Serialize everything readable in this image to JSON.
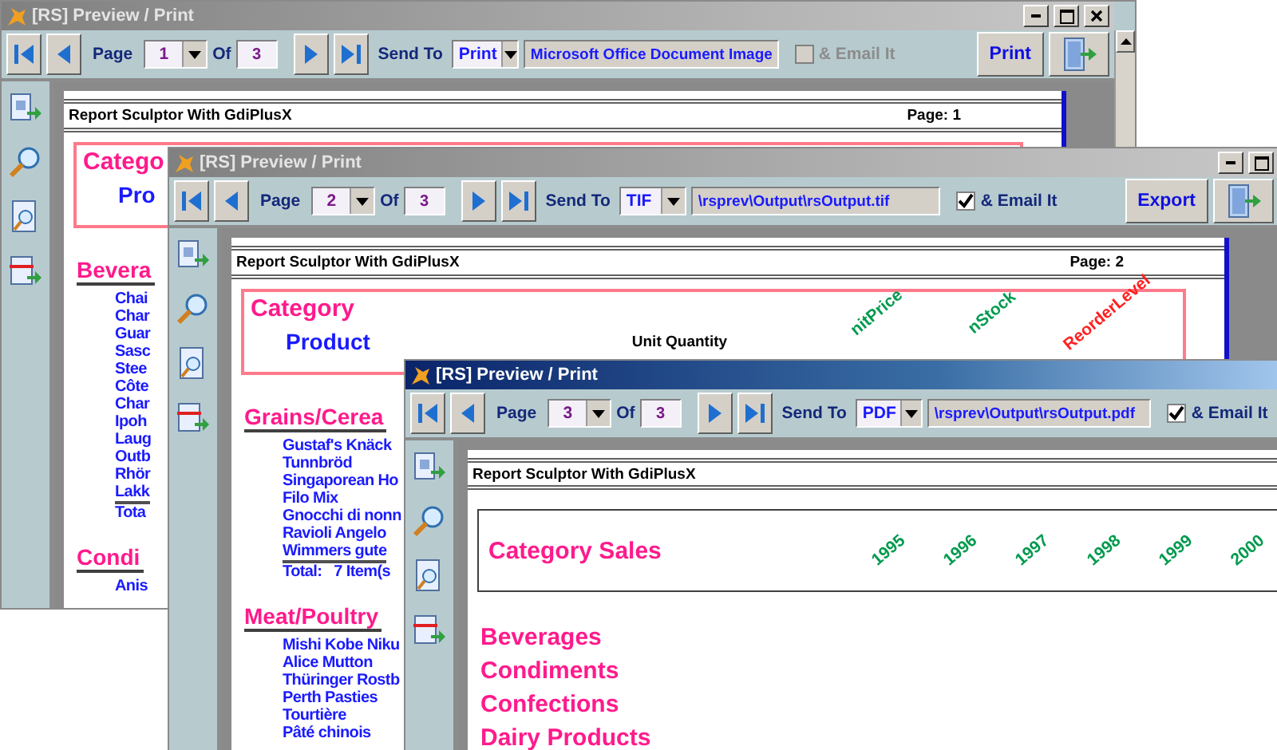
{
  "windows": [
    {
      "title": "[RS] Preview / Print",
      "active": false,
      "title_buttons": [
        {
          "kind": "minimize"
        },
        {
          "kind": "maximize"
        },
        {
          "kind": "close"
        }
      ],
      "page_label": "Page",
      "page_value": "1",
      "of_label": "Of",
      "page_total": "3",
      "send_to_label": "Send To",
      "send_to": "Print",
      "output": "Microsoft Office Document Image",
      "email": {
        "label": "& Email It",
        "checked": false,
        "disabled": true
      },
      "action": "Print",
      "report": {
        "header": "Report Sculptor With GdiPlusX",
        "page": "Page: 1",
        "box": {
          "kind": "detail",
          "title": "Catego",
          "subtitle": "Pro"
        },
        "groups": [
          {
            "kind": "detail",
            "heading": "Bevera",
            "items": [
              "Chai",
              "Char",
              "Guar",
              "Sasc",
              "Stee",
              "Côte",
              "Char",
              "Ipoh",
              "Laug",
              "Outb",
              "Rhör",
              "Lakk"
            ],
            "total": "Tota"
          },
          {
            "kind": "detail",
            "heading": "Condi",
            "items": [
              "Anis"
            ]
          }
        ]
      }
    },
    {
      "title": "[RS] Preview / Print",
      "active": false,
      "title_buttons": [
        {
          "kind": "minimize"
        },
        {
          "kind": "maximize"
        }
      ],
      "page_label": "Page",
      "page_value": "2",
      "of_label": "Of",
      "page_total": "3",
      "send_to_label": "Send To",
      "send_to": "TIF",
      "output": "\\rsprev\\Output\\rsOutput.tif",
      "email": {
        "label": "& Email It",
        "checked": true,
        "disabled": false
      },
      "action": "Export",
      "report": {
        "header": "Report Sculptor With GdiPlusX",
        "page": "Page: 2",
        "box": {
          "kind": "detail",
          "title": "Category",
          "subtitle": "Product",
          "columns": [
            {
              "text": "Unit Quantity",
              "kind": "plain"
            },
            {
              "text": "nitPrice",
              "kind": "slanted",
              "color": "#009a4e"
            },
            {
              "text": "nStock",
              "kind": "slanted",
              "color": "#009a4e"
            },
            {
              "text": "ReorderLevel",
              "kind": "slanted",
              "color": "#ff2020"
            }
          ]
        },
        "groups": [
          {
            "kind": "detail",
            "heading": "Grains/Cerea",
            "items": [
              "Gustaf's Knäck",
              "Tunnbröd",
              "Singaporean Ho",
              "Filo Mix",
              "Gnocchi di nonn",
              "Ravioli Angelo",
              "Wimmers gute"
            ],
            "total": "Total:   7 Item(s"
          },
          {
            "kind": "detail",
            "heading": "Meat/Poultry",
            "items": [
              "Mishi Kobe Niku",
              "Alice Mutton",
              "Thüringer Rostb",
              "Perth Pasties",
              "Tourtière",
              "Pâté chinois"
            ]
          }
        ]
      }
    },
    {
      "title": "[RS] Preview / Print",
      "active": true,
      "page_label": "Page",
      "page_value": "3",
      "of_label": "Of",
      "page_total": "3",
      "send_to_label": "Send To",
      "send_to": "PDF",
      "output": "\\rsprev\\Output\\rsOutput.pdf",
      "email": {
        "label": "& Email It",
        "checked": true,
        "disabled": false
      },
      "report": {
        "header": "Report Sculptor With GdiPlusX",
        "box": {
          "kind": "summary",
          "title": "Category Sales",
          "columns": [
            {
              "text": "1995",
              "kind": "slanted",
              "color": "#009a4e"
            },
            {
              "text": "1996",
              "kind": "slanted",
              "color": "#009a4e"
            },
            {
              "text": "1997",
              "kind": "slanted",
              "color": "#009a4e"
            },
            {
              "text": "1998",
              "kind": "slanted",
              "color": "#009a4e"
            },
            {
              "text": "1999",
              "kind": "slanted",
              "color": "#009a4e"
            },
            {
              "text": "2000",
              "kind": "slanted",
              "color": "#009a4e"
            }
          ]
        },
        "groups": [
          {
            "kind": "summary",
            "heading": "Beverages"
          },
          {
            "kind": "summary",
            "heading": "Condiments"
          },
          {
            "kind": "summary",
            "heading": "Confections"
          },
          {
            "kind": "summary",
            "heading": "Dairy Products"
          }
        ]
      }
    }
  ]
}
